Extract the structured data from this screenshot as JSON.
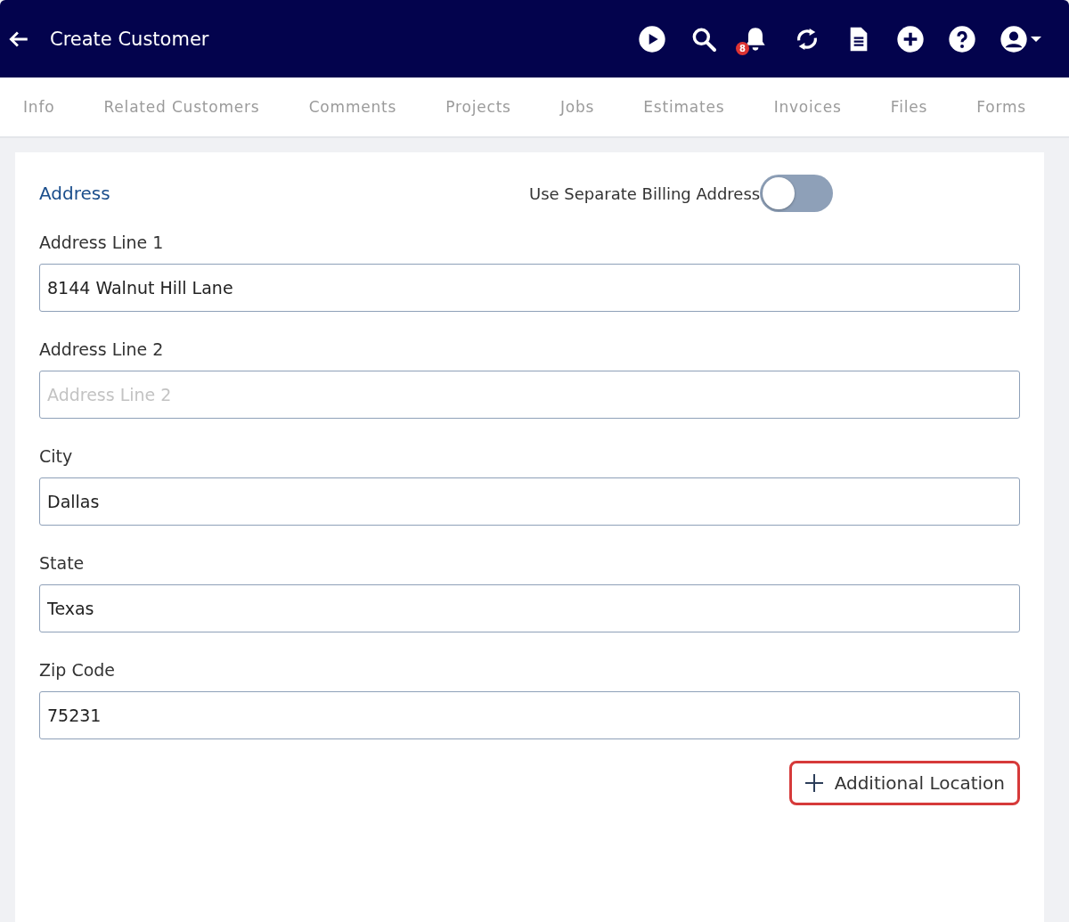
{
  "header": {
    "title": "Create Customer",
    "notification_count": "8"
  },
  "tabs": [
    {
      "label": "Info",
      "selected": false
    },
    {
      "label": "Related Customers",
      "selected": false
    },
    {
      "label": "Comments",
      "selected": false
    },
    {
      "label": "Projects",
      "selected": false
    },
    {
      "label": "Jobs",
      "selected": false
    },
    {
      "label": "Estimates",
      "selected": false
    },
    {
      "label": "Invoices",
      "selected": false
    },
    {
      "label": "Files",
      "selected": false
    },
    {
      "label": "Forms",
      "selected": false
    }
  ],
  "section": {
    "title": "Address",
    "billing_toggle": {
      "label": "Use Separate Billing Address",
      "on": false
    }
  },
  "fields": [
    {
      "label": "Address Line 1",
      "value": "8144 Walnut Hill Lane"
    },
    {
      "label": "Address Line 2",
      "placeholder": "Address Line 2"
    },
    {
      "label": "City",
      "value": "Dallas"
    },
    {
      "label": "State",
      "value": "Texas"
    },
    {
      "label": "Zip Code",
      "value": "75231"
    }
  ],
  "add_button": {
    "label": "Additional Location"
  }
}
